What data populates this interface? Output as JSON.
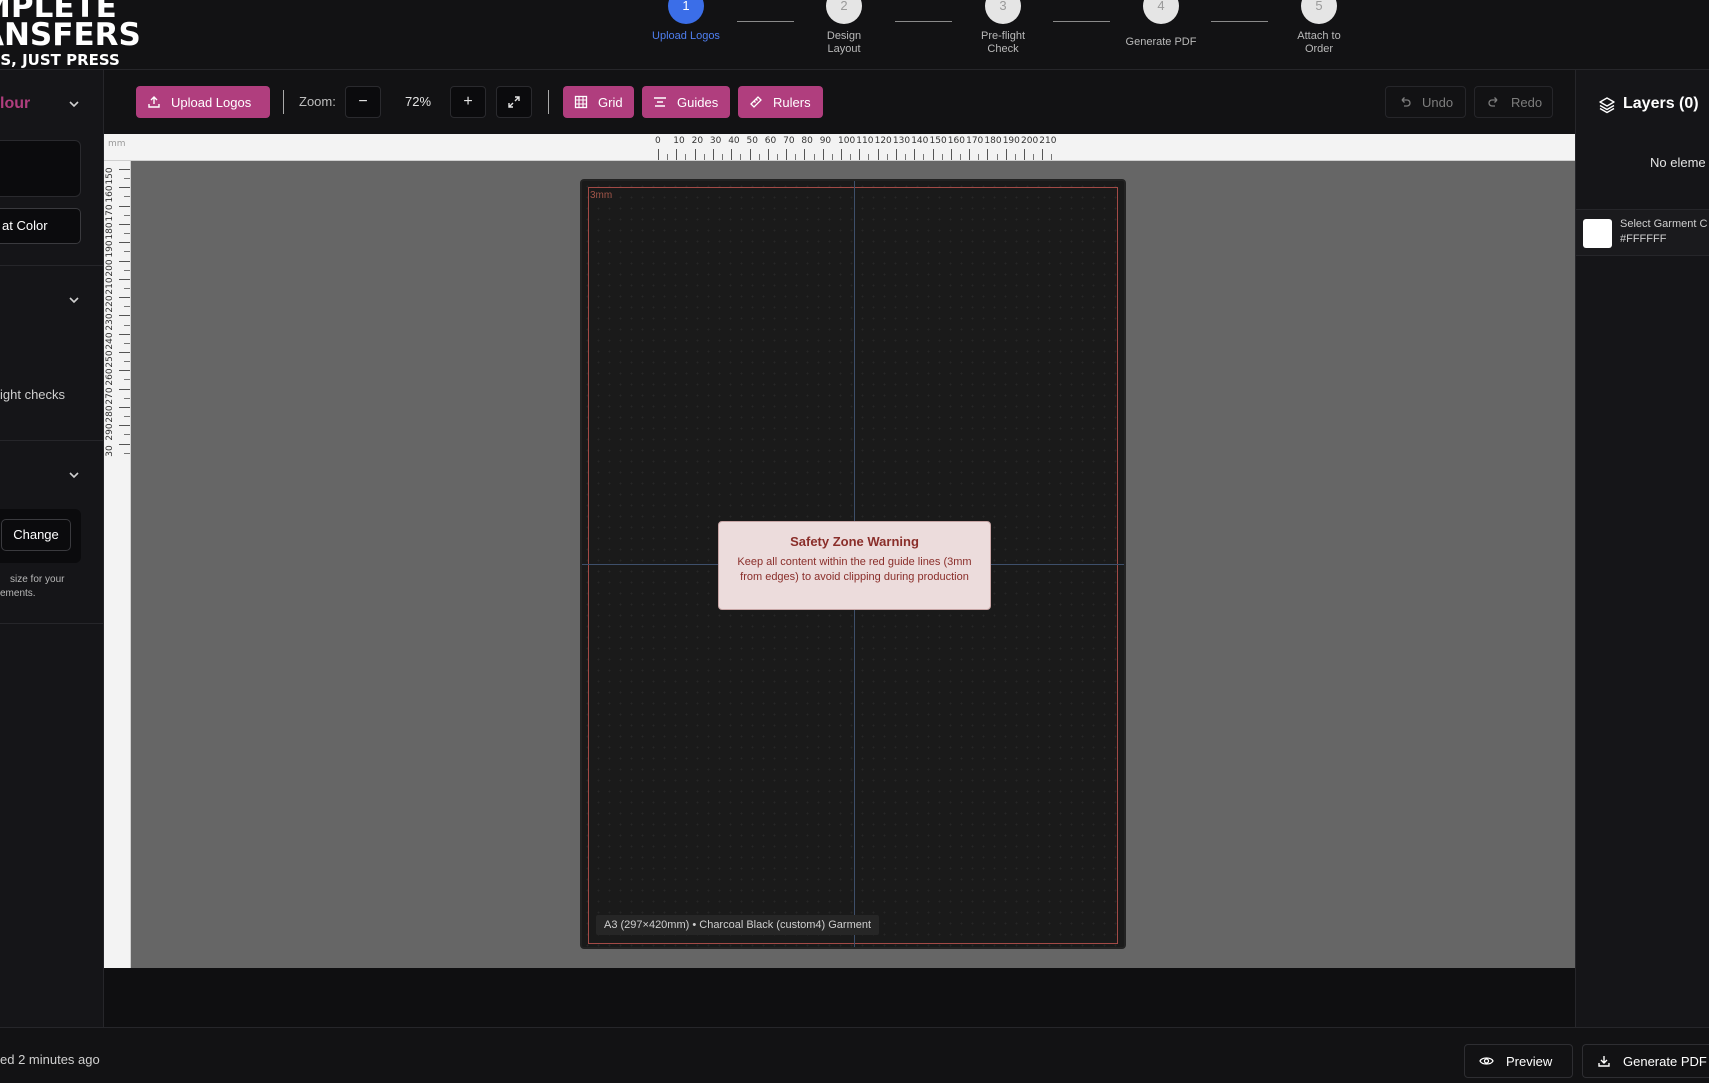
{
  "header": {
    "logo": {
      "line1": "MPLETE",
      "line2": "ANSFERS",
      "line3": "ESS, JUST PRESS"
    },
    "steps": [
      {
        "number": "1",
        "label": "Upload Logos"
      },
      {
        "number": "2",
        "label": "Design Layout"
      },
      {
        "number": "3",
        "label": "Pre-flight Check"
      },
      {
        "number": "4",
        "label": "Generate PDF"
      },
      {
        "number": "5",
        "label": "Attach to Order"
      }
    ]
  },
  "left_panel": {
    "section1_title": "lour",
    "color_button_label": "at Color",
    "preflight_text": "ight checks",
    "change_button": "Change",
    "size_help_line1": "size for your",
    "size_help_line2": "ements."
  },
  "toolbar": {
    "upload_label": "Upload Logos",
    "zoom_label": "Zoom:",
    "zoom_out_icon": "−",
    "zoom_value": "72%",
    "zoom_in_icon": "+",
    "fit_icon": "⤢",
    "grid_label": "Grid",
    "guides_label": "Guides",
    "rulers_label": "Rulers",
    "undo_label": "Undo",
    "redo_label": "Redo"
  },
  "ruler": {
    "unit": "mm",
    "top_ticks": [
      "0",
      "10",
      "20",
      "30",
      "40",
      "50",
      "60",
      "70",
      "80",
      "90",
      "100",
      "110",
      "120",
      "130",
      "140",
      "150",
      "160",
      "170",
      "180",
      "190",
      "200",
      "210"
    ],
    "left_ticks": [
      "150",
      "160",
      "170",
      "180",
      "190",
      "200",
      "210",
      "220",
      "230",
      "240",
      "250",
      "260",
      "270",
      "280",
      "290",
      "30"
    ]
  },
  "sheet": {
    "margin_label": "3mm",
    "warning_title": "Safety Zone Warning",
    "warning_text": "Keep all content within the red guide lines (3mm from edges) to avoid clipping during production",
    "info_label": "A3 (297×420mm) • Charcoal Black (custom4) Garment"
  },
  "right_panel": {
    "title": "Layers (0)",
    "empty_text": "No eleme",
    "garment_label": "Select Garment C",
    "garment_hex": "#FFFFFF"
  },
  "footer": {
    "saved_text": "ed 2 minutes ago",
    "preview_label": "Preview",
    "generate_label": "Generate PDF"
  },
  "colors": {
    "accent": "#b03e7e",
    "step_active": "#3b6ee8",
    "safety_line": "#a24a46",
    "canvas_bg": "#666666"
  }
}
